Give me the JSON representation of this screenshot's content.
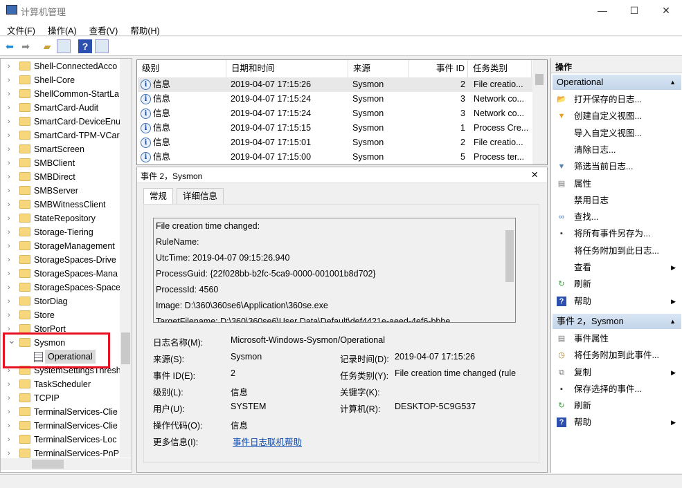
{
  "window": {
    "title": "计算机管理",
    "minimize": "—",
    "maximize": "☐",
    "close": "✕"
  },
  "menu": [
    "文件(F)",
    "操作(A)",
    "查看(V)",
    "帮助(H)"
  ],
  "tree": {
    "items": [
      {
        "label": "Shell-ConnectedAcco",
        "expanded": false
      },
      {
        "label": "Shell-Core"
      },
      {
        "label": "ShellCommon-StartLa"
      },
      {
        "label": "SmartCard-Audit"
      },
      {
        "label": "SmartCard-DeviceEnu"
      },
      {
        "label": "SmartCard-TPM-VCar"
      },
      {
        "label": "SmartScreen"
      },
      {
        "label": "SMBClient"
      },
      {
        "label": "SMBDirect"
      },
      {
        "label": "SMBServer"
      },
      {
        "label": "SMBWitnessClient"
      },
      {
        "label": "StateRepository"
      },
      {
        "label": "Storage-Tiering"
      },
      {
        "label": "StorageManagement"
      },
      {
        "label": "StorageSpaces-Drive"
      },
      {
        "label": "StorageSpaces-Mana"
      },
      {
        "label": "StorageSpaces-Space"
      },
      {
        "label": "StorDiag"
      },
      {
        "label": "Store"
      },
      {
        "label": "StorPort"
      },
      {
        "label": "Sysmon",
        "expanded": true
      },
      {
        "label": "Operational",
        "child": true,
        "selected": true
      },
      {
        "label": "SystemSettingsThresh"
      },
      {
        "label": "TaskScheduler"
      },
      {
        "label": "TCPIP"
      },
      {
        "label": "TerminalServices-Clie"
      },
      {
        "label": "TerminalServices-Clie"
      },
      {
        "label": "TerminalServices-Loc"
      },
      {
        "label": "TerminalServices-PnP"
      }
    ],
    "highlight_color": "#e81123"
  },
  "events": {
    "columns": [
      "级别",
      "日期和时间",
      "来源",
      "事件 ID",
      "任务类别"
    ],
    "rows": [
      {
        "level": "信息",
        "datetime": "2019-04-07 17:15:26",
        "source": "Sysmon",
        "id": "2",
        "task": "File creatio..."
      },
      {
        "level": "信息",
        "datetime": "2019-04-07 17:15:24",
        "source": "Sysmon",
        "id": "3",
        "task": "Network co..."
      },
      {
        "level": "信息",
        "datetime": "2019-04-07 17:15:24",
        "source": "Sysmon",
        "id": "3",
        "task": "Network co..."
      },
      {
        "level": "信息",
        "datetime": "2019-04-07 17:15:15",
        "source": "Sysmon",
        "id": "1",
        "task": "Process Cre..."
      },
      {
        "level": "信息",
        "datetime": "2019-04-07 17:15:01",
        "source": "Sysmon",
        "id": "2",
        "task": "File creatio..."
      },
      {
        "level": "信息",
        "datetime": "2019-04-07 17:15:00",
        "source": "Sysmon",
        "id": "5",
        "task": "Process ter..."
      }
    ]
  },
  "detail": {
    "title": "事件 2，Sysmon",
    "close": "✕",
    "tabs": [
      "常规",
      "详细信息"
    ],
    "text_lines": [
      "File creation time changed:",
      "RuleName:",
      "UtcTime: 2019-04-07 09:15:26.940",
      "ProcessGuid: {22f028bb-b2fc-5ca9-0000-001001b8d702}",
      "ProcessId: 4560",
      "Image: D:\\360\\360se6\\Application\\360se.exe",
      "TargetFilename: D:\\360\\360se6\\User Data\\Default\\def4421e-aeed-4ef6-bbbe"
    ],
    "fields": {
      "log_name_label": "日志名称(M):",
      "log_name": "Microsoft-Windows-Sysmon/Operational",
      "source_label": "来源(S):",
      "source": "Sysmon",
      "logged_label": "记录时间(D):",
      "logged": "2019-04-07 17:15:26",
      "event_id_label": "事件 ID(E):",
      "event_id": "2",
      "task_label": "任务类别(Y):",
      "task": "File creation time changed (rule",
      "level_label": "级别(L):",
      "level": "信息",
      "keywords_label": "关键字(K):",
      "keywords": "",
      "user_label": "用户(U):",
      "user": "SYSTEM",
      "computer_label": "计算机(R):",
      "computer": "DESKTOP-5C9G537",
      "opcode_label": "操作代码(O):",
      "opcode": "信息",
      "more_info_label": "更多信息(I):",
      "more_info_link": "事件日志联机帮助"
    }
  },
  "actions": {
    "header": "操作",
    "sections": [
      {
        "title": "Operational",
        "items": [
          {
            "label": "打开保存的日志...",
            "icon": "open-folder-icon"
          },
          {
            "label": "创建自定义视图...",
            "icon": "filter-create-icon"
          },
          {
            "label": "导入自定义视图...",
            "icon": ""
          },
          {
            "label": "清除日志...",
            "icon": ""
          },
          {
            "label": "筛选当前日志...",
            "icon": "filter-icon"
          },
          {
            "label": "属性",
            "icon": "properties-icon"
          },
          {
            "label": "禁用日志",
            "icon": ""
          },
          {
            "label": "查找...",
            "icon": "binoculars-icon"
          },
          {
            "label": "将所有事件另存为...",
            "icon": "save-icon"
          },
          {
            "label": "将任务附加到此日志...",
            "icon": ""
          },
          {
            "label": "查看",
            "icon": "",
            "submenu": true
          },
          {
            "label": "刷新",
            "icon": "refresh-icon"
          },
          {
            "label": "帮助",
            "icon": "help-icon",
            "submenu": true
          }
        ]
      },
      {
        "title": "事件 2，Sysmon",
        "items": [
          {
            "label": "事件属性",
            "icon": "properties-icon"
          },
          {
            "label": "将任务附加到此事件...",
            "icon": "task-clock-icon"
          },
          {
            "label": "复制",
            "icon": "copy-icon",
            "submenu": true
          },
          {
            "label": "保存选择的事件...",
            "icon": "save-icon"
          },
          {
            "label": "刷新",
            "icon": "refresh-icon"
          },
          {
            "label": "帮助",
            "icon": "help-icon",
            "submenu": true
          }
        ]
      }
    ]
  }
}
